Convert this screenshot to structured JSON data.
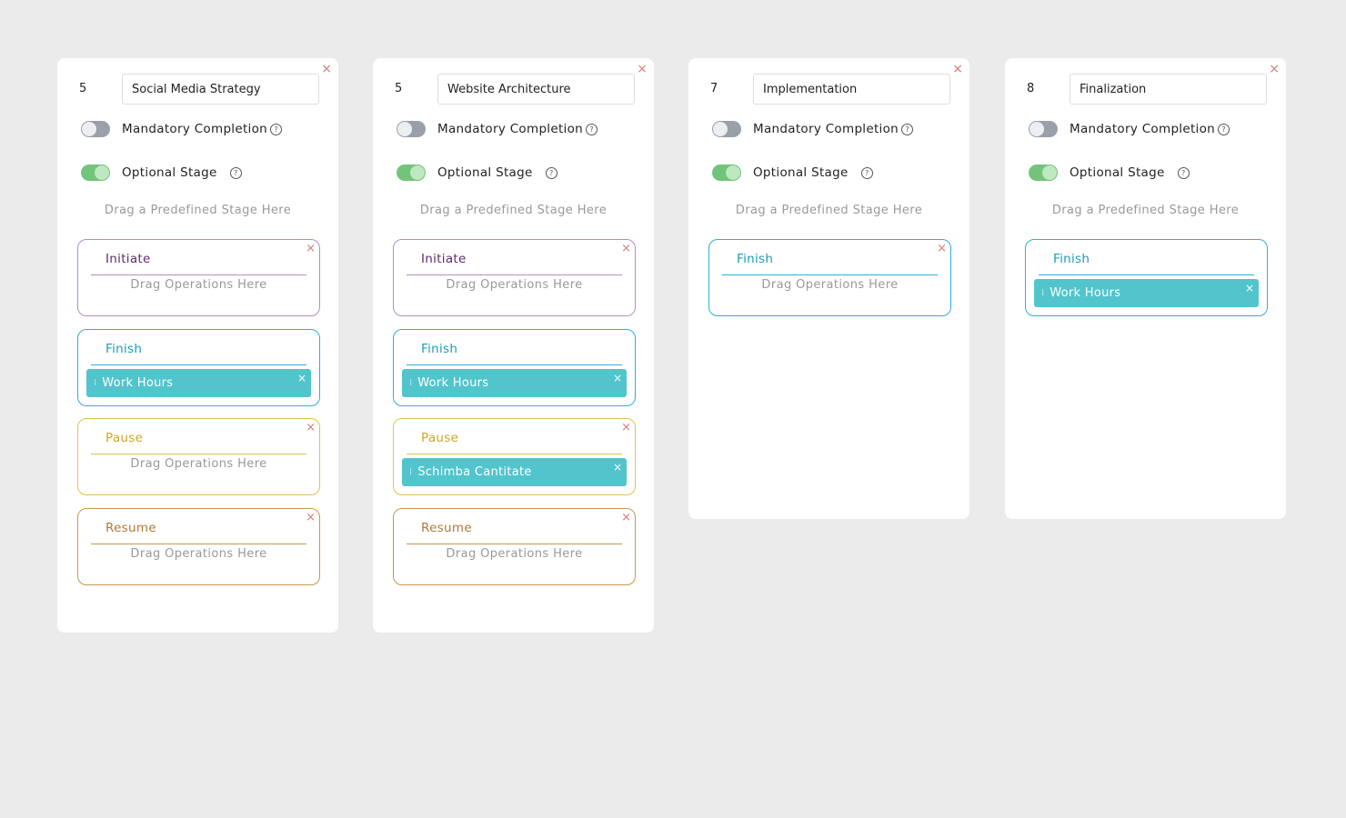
{
  "colors": {
    "initiate": "#b58dc7",
    "initiate_title": "#5e2a6e",
    "finish": "#2db1d6",
    "finish_title": "#1a9cbf",
    "pause": "#e2c24f",
    "pause_title": "#cfa52a",
    "resume": "#c9974d",
    "resume_title": "#b0783a",
    "operation_bg": "#52c4cc",
    "close": "#d47a7a"
  },
  "labels": {
    "mandatory": "Mandatory Completion",
    "optional": "Optional Stage",
    "drag_predefined": "Drag a Predefined Stage Here",
    "drag_operations": "Drag Operations Here",
    "close_icon": "×",
    "help_icon": "?",
    "handle_icon": "⁞"
  },
  "cards": [
    {
      "number": "5",
      "name": "Social Media Strategy",
      "mandatory": false,
      "optional": true,
      "stages": [
        {
          "key": "initiate",
          "title": "Initiate",
          "operations": []
        },
        {
          "key": "finish",
          "title": "Finish",
          "closable": false,
          "operations": [
            "Work Hours"
          ]
        },
        {
          "key": "pause",
          "title": "Pause",
          "operations": []
        },
        {
          "key": "resume",
          "title": "Resume",
          "operations": []
        }
      ]
    },
    {
      "number": "5",
      "name": "Website Architecture",
      "mandatory": false,
      "optional": true,
      "stages": [
        {
          "key": "initiate",
          "title": "Initiate",
          "operations": []
        },
        {
          "key": "finish",
          "title": "Finish",
          "closable": false,
          "operations": [
            "Work Hours"
          ]
        },
        {
          "key": "pause",
          "title": "Pause",
          "operations": [
            "Schimba Cantitate"
          ]
        },
        {
          "key": "resume",
          "title": "Resume",
          "operations": []
        }
      ]
    },
    {
      "number": "7",
      "name": "Implementation",
      "mandatory": false,
      "optional": true,
      "stages": [
        {
          "key": "finish",
          "title": "Finish",
          "operations": []
        }
      ]
    },
    {
      "number": "8",
      "name": "Finalization",
      "mandatory": false,
      "optional": true,
      "stages": [
        {
          "key": "finish",
          "title": "Finish",
          "closable": false,
          "operations": [
            "Work Hours"
          ]
        }
      ]
    }
  ]
}
